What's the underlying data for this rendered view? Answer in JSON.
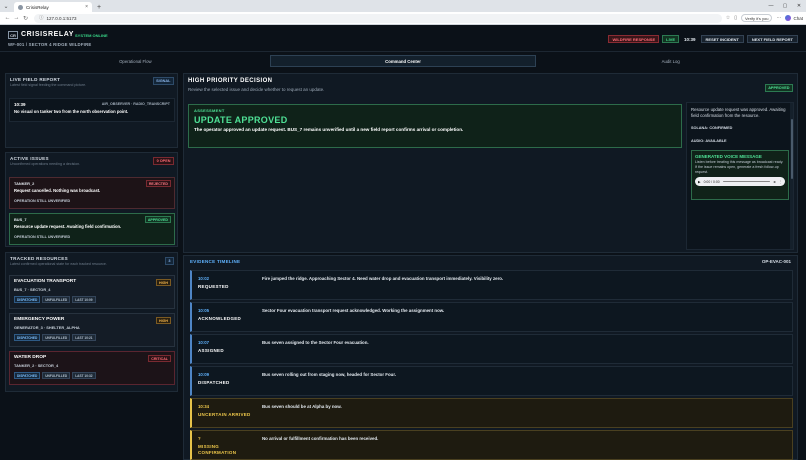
{
  "browser": {
    "tab_title": "CrisisRelay",
    "url": "127.0.0.1:5173",
    "verify_label": "Verify it's you",
    "chat_label": "Chat"
  },
  "header": {
    "logo": "CR",
    "brand": "CRISISRELAY",
    "system_status": "SYSTEM ONLINE",
    "incident": "WF-001 / SECTOR 4 RIDGE WILDFIRE",
    "badge_wildfire": "WILDFIRE RESPONSE",
    "badge_live": "LIVE",
    "clock": "10:39",
    "reset_label": "RESET INCIDENT",
    "next_label": "NEXT FIELD REPORT"
  },
  "tabs": [
    {
      "label": "Operational Flow"
    },
    {
      "label": "Command Center"
    },
    {
      "label": "Audit Log"
    }
  ],
  "live_report": {
    "title": "LIVE FIELD REPORT",
    "subtitle": "Latest field signal feeding the command picture.",
    "pill": "SIGNAL",
    "time": "10:39",
    "source": "AIR_OBSERVER · RADIO_TRANSCRIPT",
    "text": "No visual on tanker two from the north observation point."
  },
  "active_issues": {
    "title": "ACTIVE ISSUES",
    "subtitle": "Unconfirmed operations needing a decision.",
    "pill": "0 OPEN",
    "items": [
      {
        "name": "TANKER_2",
        "state": "REJECTED",
        "text": "Request cancelled. Nothing was broadcast.",
        "footer": "OPERATION STILL UNVERIFIED"
      },
      {
        "name": "BUS_7",
        "state": "APPROVED",
        "text": "Resource update request. Awaiting field confirmation.",
        "footer": "OPERATION STILL UNVERIFIED"
      }
    ]
  },
  "tracked": {
    "title": "TRACKED RESOURCES",
    "subtitle": "Latest confirmed operational state for each tracked resource.",
    "pill": "3",
    "items": [
      {
        "name": "EVACUATION TRANSPORT",
        "priority": "HIGH",
        "sub": "BUS_7 · SECTOR_4",
        "tags": [
          "DISPATCHED",
          "UNFULFILLED",
          "LAST 10:09"
        ]
      },
      {
        "name": "EMERGENCY POWER",
        "priority": "HIGH",
        "sub": "GENERATOR_3 · SHELTER_ALPHA",
        "tags": [
          "DISPATCHED",
          "UNFULFILLED",
          "LAST 10:21"
        ]
      },
      {
        "name": "WATER DROP",
        "priority": "CRITICAL",
        "sub": "TANKER_2 · SECTOR_4",
        "tags": [
          "DISPATCHED",
          "UNFULFILLED",
          "LAST 10:32"
        ]
      }
    ]
  },
  "decision": {
    "title": "HIGH PRIORITY DECISION",
    "subtitle": "Review the selected issue and decide whether to request an update.",
    "pill": "APPROVED",
    "assessment_label": "ASSESSMENT",
    "heading": "UPDATE APPROVED",
    "text": "The operator approved an update request. BUS_7 remains unverified until a new field report confirms arrival or completion.",
    "side_message": "Resource update request was approved. Awaiting field confirmation from the resource.",
    "solana": "SOLANA: CONFIRMED",
    "audio": "AUDIO: AVAILABLE",
    "voice_title": "GENERATED VOICE MESSAGE",
    "voice_text": "Listen before treating this message as broadcast ready. If the issue remains open, generate a fresh follow-up request.",
    "player_time": "0:00 / 0:00"
  },
  "timeline": {
    "title": "EVIDENCE TIMELINE",
    "code": "OP-EVAC-001",
    "events": [
      {
        "time": "10:02",
        "stage": "REQUESTED",
        "text": "Fire jumped the ridge. Approaching Sector 4. Need water drop and evacuation transport immediately. Visibility zero.",
        "warn": false
      },
      {
        "time": "10:05",
        "stage": "ACKNOWLEDGED",
        "text": "Sector Four evacuation transport request acknowledged. Working the assignment now.",
        "warn": false
      },
      {
        "time": "10:07",
        "stage": "ASSIGNED",
        "text": "Bus seven assigned to the Sector Four evacuation.",
        "warn": false
      },
      {
        "time": "10:09",
        "stage": "DISPATCHED",
        "text": "Bus seven rolling out from staging now, headed for Sector Four.",
        "warn": false
      },
      {
        "time": "10:34",
        "stage": "UNCERTAIN ARRIVED",
        "text": "Bus seven should be at Alpha by now.",
        "warn": true
      },
      {
        "time": "?",
        "stage": "MISSING CONFIRMATION",
        "text": "No arrival or fulfillment confirmation has been received.",
        "warn": true
      }
    ]
  }
}
